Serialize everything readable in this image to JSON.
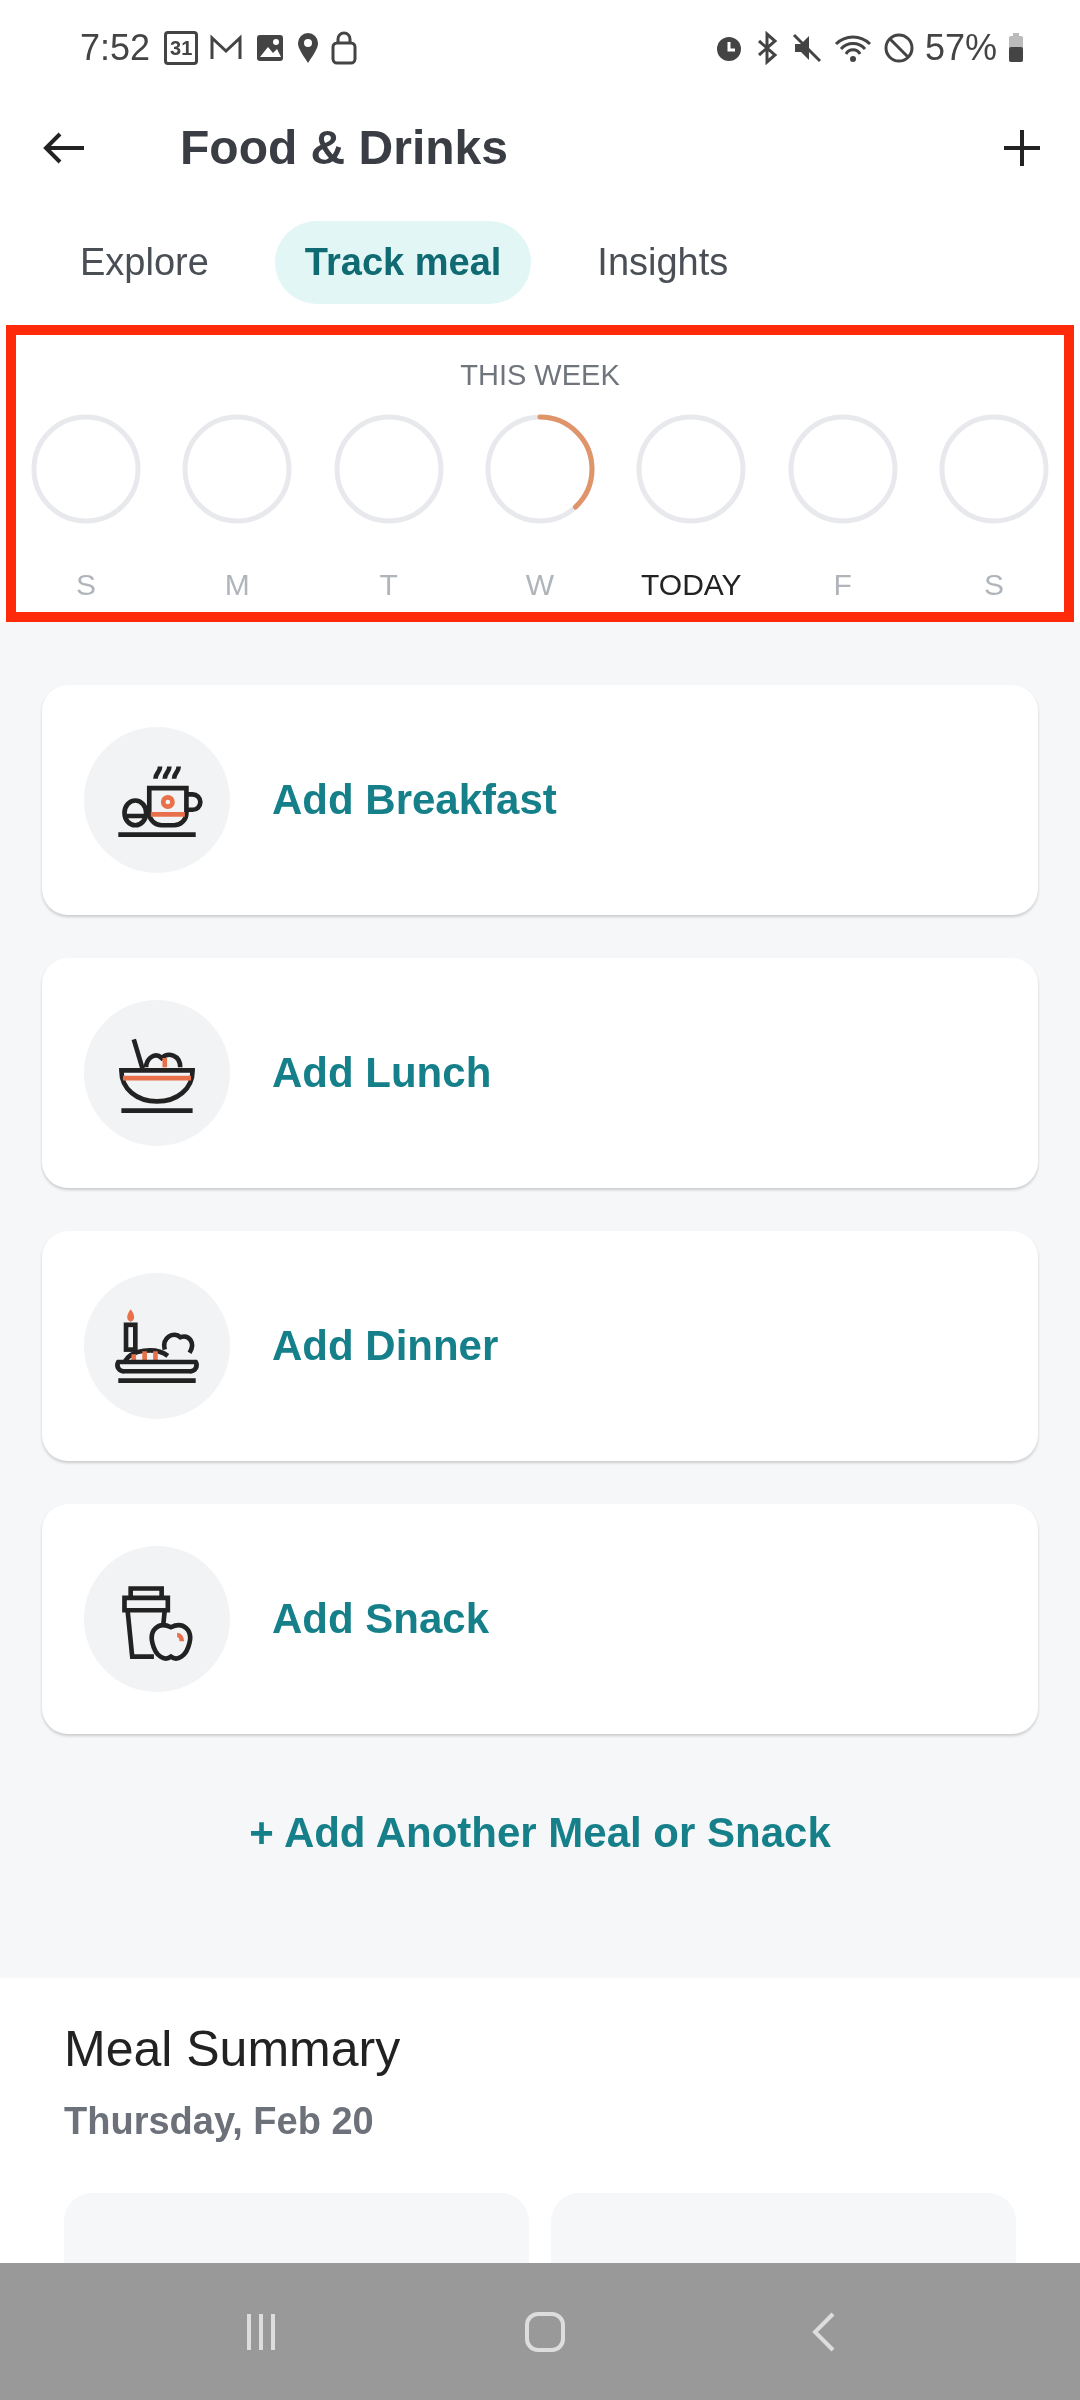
{
  "status_bar": {
    "time": "7:52",
    "calendar_day": "31",
    "battery": "57%"
  },
  "header": {
    "title": "Food & Drinks"
  },
  "tabs": [
    {
      "label": "Explore",
      "selected": false
    },
    {
      "label": "Track meal",
      "selected": true
    },
    {
      "label": "Insights",
      "selected": false
    }
  ],
  "week": {
    "title": "THIS WEEK",
    "highlighted": true,
    "days": [
      {
        "label": "S",
        "today": false
      },
      {
        "label": "M",
        "today": false
      },
      {
        "label": "T",
        "today": false
      },
      {
        "label": "W",
        "today": false,
        "level": 0.38
      },
      {
        "label": "TODAY",
        "today": true
      },
      {
        "label": "F",
        "today": false
      },
      {
        "label": "S",
        "today": false
      }
    ]
  },
  "meals": [
    {
      "kind": "breakfast",
      "label": "Add Breakfast"
    },
    {
      "kind": "lunch",
      "label": "Add Lunch"
    },
    {
      "kind": "dinner",
      "label": "Add Dinner"
    },
    {
      "kind": "snack",
      "label": "Add Snack"
    }
  ],
  "add_another": "+ Add Another Meal or Snack",
  "summary": {
    "title": "Meal Summary",
    "date": "Thursday, Feb 20"
  }
}
